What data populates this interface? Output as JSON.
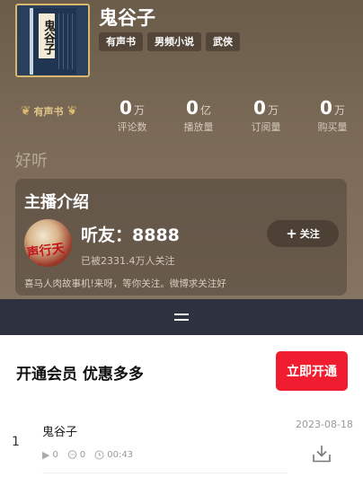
{
  "book": {
    "cover_text": "鬼谷子",
    "title": "鬼谷子",
    "tags": [
      "有声书",
      "男频小说",
      "武侠"
    ]
  },
  "stats": {
    "badge": "有声书",
    "items": [
      {
        "value": "0",
        "unit": "万",
        "label": "评论数"
      },
      {
        "value": "0",
        "unit": "亿",
        "label": "播放量"
      },
      {
        "value": "0",
        "unit": "万",
        "label": "订阅量"
      },
      {
        "value": "0",
        "unit": "万",
        "label": "购买量"
      }
    ]
  },
  "section_title": "好听",
  "host": {
    "heading": "主播介绍",
    "avatar_text": "声行天下",
    "name": "听友：8888",
    "followers": "已被2331.4万人关注",
    "follow_label": "关注",
    "description": "喜马人肉故事机!来呀，等你关注。微博求关注好"
  },
  "vip": {
    "title": "开通会员 优惠多多",
    "button": "立即开通"
  },
  "tracks": [
    {
      "index": "1",
      "title": "鬼谷子",
      "date": "2023-08-18",
      "plays": "0",
      "comments": "0",
      "duration": "00:43"
    }
  ],
  "icons": {
    "play": "play-icon",
    "comment": "comment-icon",
    "clock": "clock-icon",
    "download": "download-icon",
    "plus": "plus-icon",
    "laurel": "laurel-icon",
    "handle": "drag-handle-icon"
  },
  "colors": {
    "accent": "#ef1d2f",
    "hero": "#7a6a57",
    "bar": "#2e3140",
    "gold": "#d8b66b"
  }
}
